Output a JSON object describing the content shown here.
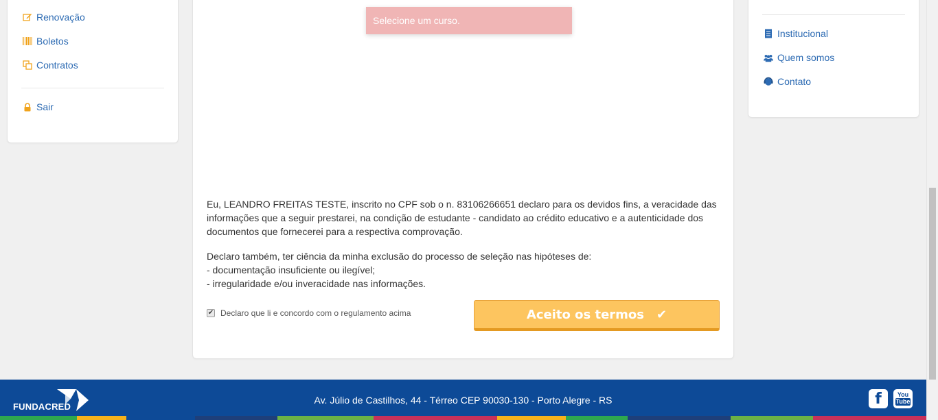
{
  "left_menu": {
    "items": [
      {
        "label": "Renovação",
        "icon": "edit-icon"
      },
      {
        "label": "Boletos",
        "icon": "barcode-icon"
      },
      {
        "label": "Contratos",
        "icon": "copy-icon"
      }
    ],
    "logout": {
      "label": "Sair",
      "icon": "lock-icon"
    }
  },
  "right_menu": {
    "items": [
      {
        "label": "Institucional",
        "icon": "book-icon"
      },
      {
        "label": "Quem somos",
        "icon": "users-icon"
      },
      {
        "label": "Contato",
        "icon": "headset-icon"
      }
    ]
  },
  "toast": {
    "message": "Selecione um curso."
  },
  "declaration": {
    "paragraph1": "Eu, LEANDRO FREITAS TESTE, inscrito no CPF sob o n. 83106266651 declaro para os devidos fins, a veracidade das informações que a seguir prestarei, na condição de estudante - candidato ao crédito educativo e a autenticidade dos documentos que fornecerei para a respectiva comprovação.",
    "paragraph2_intro": "Declaro também, ter ciência da minha exclusão do processo de seleção nas hipóteses de:",
    "paragraph2_item1": "- documentação insuficiente ou ilegível;",
    "paragraph2_item2": "- irregularidade e/ou inveracidade nas informações."
  },
  "agreement": {
    "label": "Declaro que li e concordo com o regulamento acima",
    "checked": true
  },
  "accept_button": {
    "label": "Aceito os termos",
    "icon": "check-icon"
  },
  "footer": {
    "logo_text": "FUNDACRED",
    "address": "Av. Júlio de Castilhos, 44 - Térreo CEP 90030-130 - Porto Alegre - RS",
    "facebook_glyph": "f",
    "youtube_line1": "You",
    "youtube_line2": "Tube"
  },
  "colors": {
    "link": "#2d6bb3",
    "accent": "#fdc55f",
    "footer": "#0d4a97",
    "toast": "#f0b5b5"
  }
}
